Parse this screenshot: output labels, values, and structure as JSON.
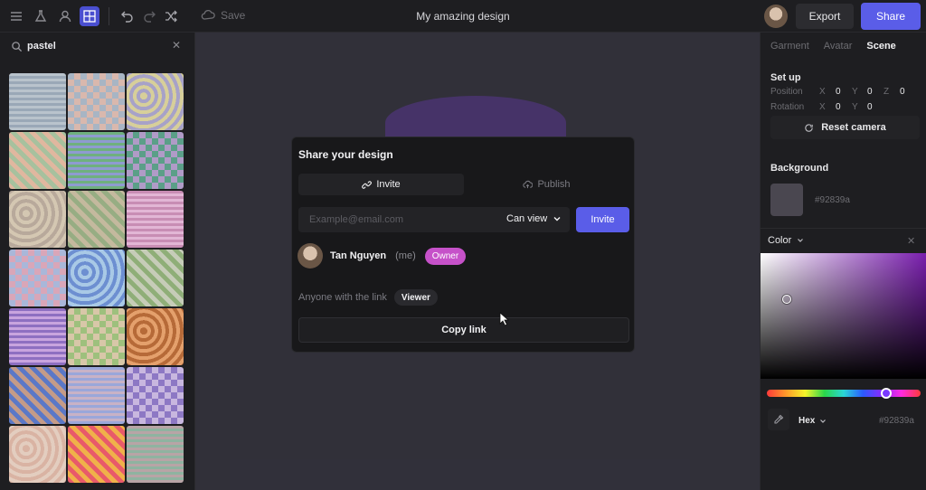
{
  "toolbar": {
    "icons": [
      "menu-icon",
      "flask-icon",
      "user-icon",
      "pattern-icon",
      "undo-icon",
      "redo-icon",
      "shuffle-icon"
    ],
    "save_label": "Save",
    "title": "My amazing design",
    "export_label": "Export",
    "share_label": "Share"
  },
  "left_panel": {
    "search_value": "pastel",
    "tile_colors": [
      [
        "#b9c3cc",
        "#9aa8b7"
      ],
      [
        "#d9b8ad",
        "#a8b5c4"
      ],
      [
        "#d7cf9a",
        "#a7a2c8"
      ],
      [
        "#e0b79f",
        "#a7c19e"
      ],
      [
        "#6fb07e",
        "#8e9bd0"
      ],
      [
        "#5b9f88",
        "#b09bc7"
      ],
      [
        "#d4c7b2",
        "#b8a99b"
      ],
      [
        "#97ad83",
        "#c4b99e"
      ],
      [
        "#c88db4",
        "#e2b6d5"
      ],
      [
        "#d9a6b8",
        "#a9b7d9"
      ],
      [
        "#6d8fd1",
        "#a9c9e6"
      ],
      [
        "#8fae78",
        "#c6ccb8"
      ],
      [
        "#8e6fc1",
        "#c8a4de"
      ],
      [
        "#9ec07d",
        "#d8c7a8"
      ],
      [
        "#b66a38",
        "#e4a06c"
      ],
      [
        "#5b78c7",
        "#c49b88"
      ],
      [
        "#9aa7da",
        "#c8b2c6"
      ],
      [
        "#8d78c4",
        "#c8b7df"
      ],
      [
        "#d9b3a3",
        "#e3cdbf"
      ],
      [
        "#e85a6a",
        "#f0b14a"
      ],
      [
        "#b8a4a6",
        "#8fb3a0"
      ]
    ]
  },
  "modal": {
    "title": "Share your design",
    "tab_invite": "Invite",
    "tab_publish": "Publish",
    "email_placeholder": "Example@email.com",
    "permission": "Can view",
    "invite_button": "Invite",
    "member_name": "Tan Nguyen",
    "member_me": "(me)",
    "member_role": "Owner",
    "link_label": "Anyone with the link",
    "link_role": "Viewer",
    "copy_link": "Copy link"
  },
  "right_panel": {
    "tabs": [
      "Garment",
      "Avatar",
      "Scene"
    ],
    "active_tab": "Scene",
    "setup_title": "Set up",
    "position_label": "Position",
    "rotation_label": "Rotation",
    "position": {
      "x": "0",
      "y": "0",
      "z": "0"
    },
    "rotation": {
      "x": "0",
      "y": "0"
    },
    "axis_labels": {
      "x": "X",
      "y": "Y",
      "z": "Z"
    },
    "reset_camera": "Reset camera",
    "background_title": "Background",
    "background_hex": "#92839a",
    "background_color": "#4a4750",
    "color_title": "Color",
    "color_mode": "Hex",
    "color_hex": "#92839a"
  },
  "colors": {
    "accent": "#5a5de8",
    "owner_badge": "#c651c9"
  }
}
